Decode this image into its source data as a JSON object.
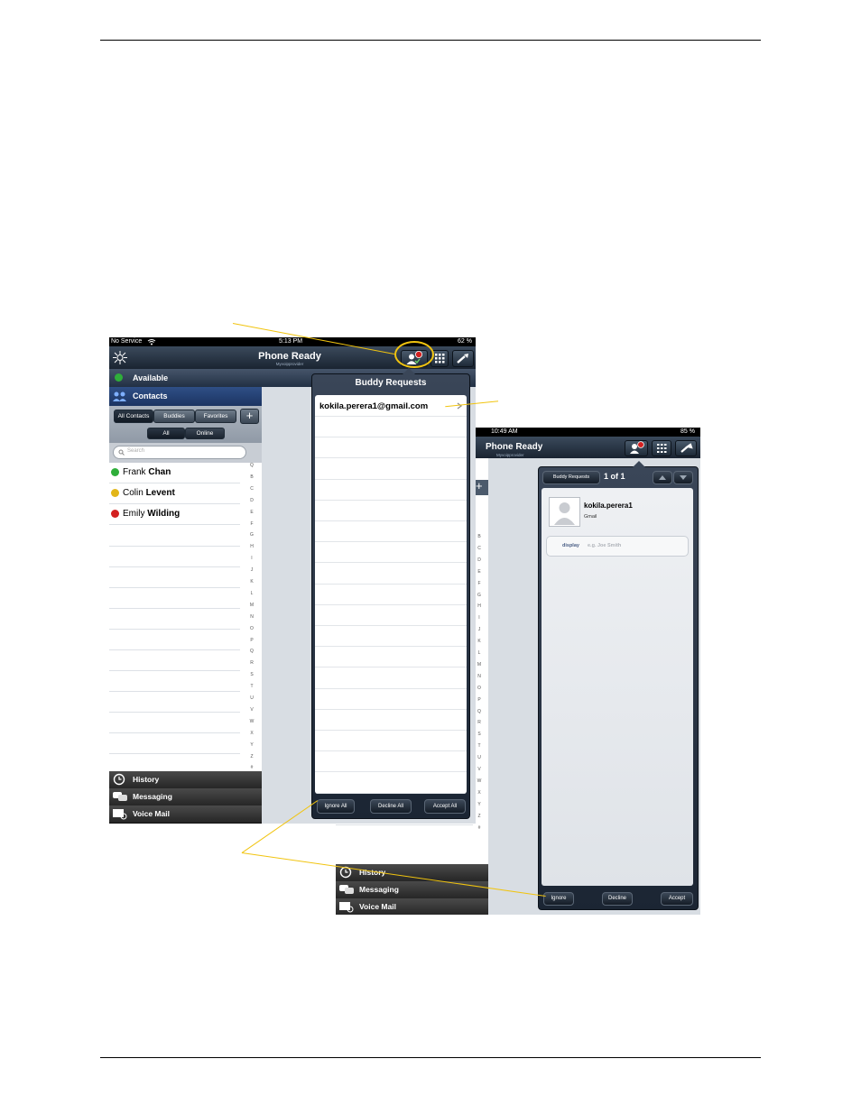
{
  "screen1": {
    "status": {
      "carrier": "No Service",
      "time": "5:13 PM",
      "battery": "62 %"
    },
    "title": "Phone Ready",
    "subtitle": "Myvoipprovider",
    "presence": "Available",
    "contacts_header": "Contacts",
    "tabs": [
      "All Contacts",
      "Buddies",
      "Favorites"
    ],
    "filter": [
      "All",
      "Online"
    ],
    "search_placeholder": "Search",
    "contacts": [
      {
        "first": "Frank",
        "last": "Chan",
        "status": "available",
        "color": "#2fae3a"
      },
      {
        "first": "Colin",
        "last": "Levent",
        "status": "away",
        "color": "#e2b619"
      },
      {
        "first": "Emily",
        "last": "Wilding",
        "status": "busy",
        "color": "#d32020"
      }
    ],
    "index_letters": [
      "Q",
      "B",
      "C",
      "D",
      "E",
      "F",
      "G",
      "H",
      "I",
      "J",
      "K",
      "L",
      "M",
      "N",
      "O",
      "P",
      "Q",
      "R",
      "S",
      "T",
      "U",
      "V",
      "W",
      "X",
      "Y",
      "Z",
      "#"
    ],
    "bottom_items": [
      "History",
      "Messaging",
      "Voice Mail"
    ]
  },
  "popover1": {
    "title": "Buddy Requests",
    "request": "kokila.perera1@gmail.com",
    "buttons": [
      "Ignore All",
      "Decline All",
      "Accept All"
    ]
  },
  "screen2": {
    "status": {
      "time": "10:49 AM",
      "battery": "85 %"
    },
    "title": "Phone Ready",
    "subtitle": "Myvoipprovider",
    "popover_tab": "Buddy Requests",
    "counter": "1 of 1",
    "name": "kokila.perera1",
    "account": "Gmail",
    "display_label": "display",
    "display_placeholder": "e.g. Joe Smith",
    "buttons": [
      "Ignore",
      "Decline",
      "Accept"
    ],
    "bottom_items": [
      "History",
      "Messaging",
      "Voice Mail"
    ],
    "index_letters": [
      "B",
      "C",
      "D",
      "E",
      "F",
      "G",
      "H",
      "I",
      "J",
      "K",
      "L",
      "M",
      "N",
      "O",
      "P",
      "Q",
      "R",
      "S",
      "T",
      "U",
      "V",
      "W",
      "X",
      "Y",
      "Z",
      "#"
    ]
  },
  "colors": {
    "callout": "#f1c40f",
    "badge": "#d32020"
  }
}
